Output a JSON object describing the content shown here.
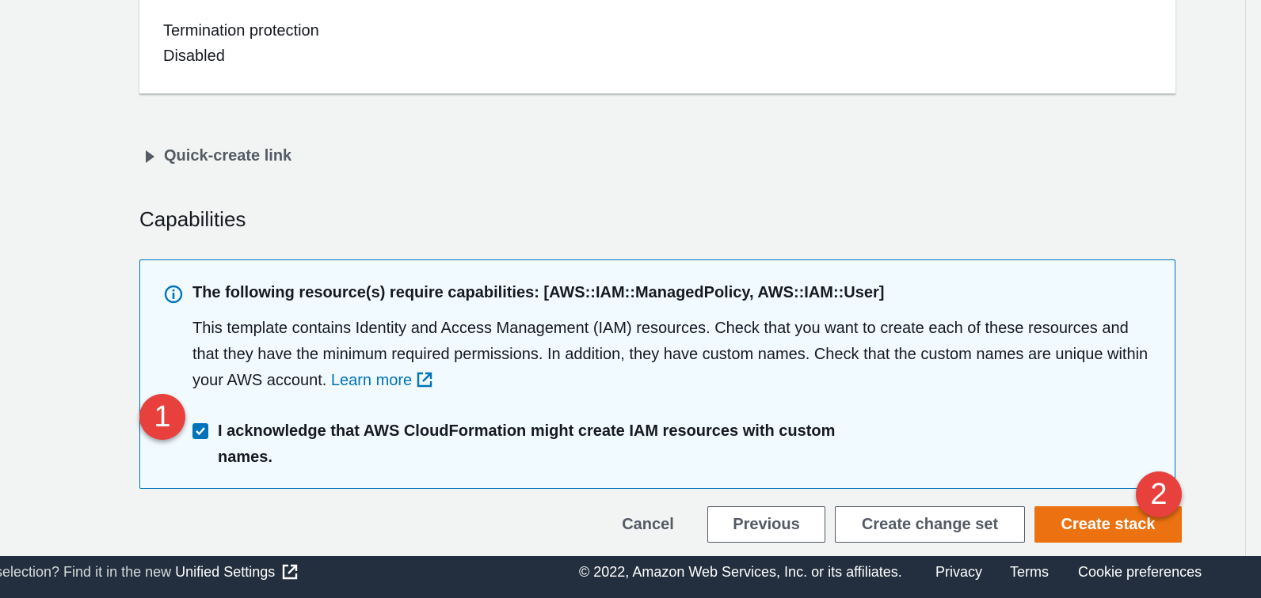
{
  "stack_details": {
    "termination_protection_label": "Termination protection",
    "termination_protection_value": "Disabled"
  },
  "quick_create": {
    "label": "Quick-create link"
  },
  "capabilities": {
    "title": "Capabilities",
    "alert_heading": "The following resource(s) require capabilities: [AWS::IAM::ManagedPolicy, AWS::IAM::User]",
    "alert_body": "This template contains Identity and Access Management (IAM) resources. Check that you want to create each of these resources and that they have the minimum required permissions. In addition, they have custom names. Check that the custom names are unique within your AWS account.",
    "learn_more": "Learn more",
    "acknowledge_text": "I acknowledge that AWS CloudFormation might create IAM resources with custom names.",
    "acknowledge_checked": true
  },
  "actions": {
    "cancel": "Cancel",
    "previous": "Previous",
    "create_change_set": "Create change set",
    "create_stack": "Create stack"
  },
  "annotations": {
    "step1": "1",
    "step2": "2"
  },
  "footer": {
    "unified_prefix": "selection? Find it in the new",
    "unified_link": "Unified Settings",
    "copyright": "© 2022, Amazon Web Services, Inc. or its affiliates.",
    "privacy": "Privacy",
    "terms": "Terms",
    "cookie_preferences": "Cookie preferences"
  },
  "colors": {
    "primary_button": "#ec7211",
    "info_blue": "#0073bb",
    "alert_background": "#f1faff",
    "footer_background": "#232f3e",
    "annotation_red": "#e8413d"
  }
}
